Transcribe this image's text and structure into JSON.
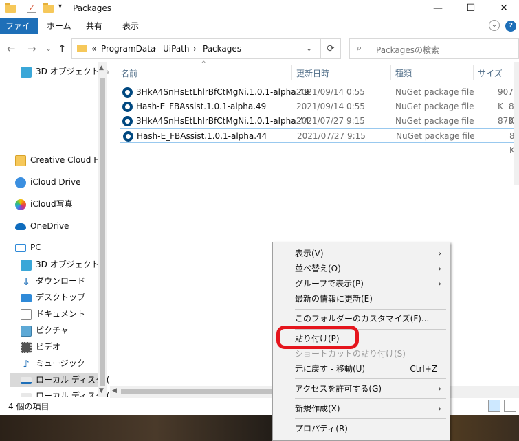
{
  "window": {
    "title": "Packages",
    "controls": {
      "minimize": "—",
      "maximize": "☐",
      "close": "✕"
    }
  },
  "ribbon": {
    "tabs": [
      "ファイル",
      "ホーム",
      "共有",
      "表示"
    ],
    "help": "?",
    "expand": "⌄"
  },
  "nav": {
    "back": "←",
    "forward": "→",
    "recent": "⌄",
    "up": "↑",
    "breadcrumb": [
      "«",
      "ProgramData",
      "›",
      "UiPath",
      "›",
      "Packages"
    ],
    "refresh": "⟳",
    "search_placeholder": "Packagesの検索",
    "search_icon": "⌕"
  },
  "sidebar": {
    "items": [
      {
        "label": "3D オブジェクト",
        "icon": "3d-objects-icon",
        "pin": "📌"
      },
      {
        "label": "Creative Cloud File",
        "icon": "creative-cloud-icon"
      },
      {
        "label": "iCloud Drive",
        "icon": "icloud-drive-icon"
      },
      {
        "label": "iCloud写真",
        "icon": "icloud-photos-icon"
      },
      {
        "label": "OneDrive",
        "icon": "onedrive-icon"
      },
      {
        "label": "PC",
        "icon": "pc-icon"
      },
      {
        "label": "3D オブジェクト",
        "icon": "3d-objects-icon"
      },
      {
        "label": "ダウンロード",
        "icon": "downloads-icon"
      },
      {
        "label": "デスクトップ",
        "icon": "desktop-icon"
      },
      {
        "label": "ドキュメント",
        "icon": "documents-icon"
      },
      {
        "label": "ピクチャ",
        "icon": "pictures-icon"
      },
      {
        "label": "ビデオ",
        "icon": "videos-icon"
      },
      {
        "label": "ミュージック",
        "icon": "music-icon"
      },
      {
        "label": "ローカル ディスク (C",
        "icon": "local-disk-icon"
      },
      {
        "label": "ローカル ディスク (D",
        "icon": "local-disk-icon"
      }
    ]
  },
  "filelist": {
    "columns": [
      "名前",
      "更新日時",
      "種類",
      "サイズ"
    ],
    "rows": [
      {
        "name": "3HkA4SnHsEtLhlrBfCtMgNi.1.0.1-alpha.49",
        "date": "2021/09/14 0:55",
        "type": "NuGet package file",
        "size": "907 K"
      },
      {
        "name": "Hash-E_FBAssist.1.0.1-alpha.49",
        "date": "2021/09/14 0:55",
        "type": "NuGet package file",
        "size": "8 K"
      },
      {
        "name": "3HkA4SnHsEtLhlrBfCtMgNi.1.0.1-alpha.44",
        "date": "2021/07/27 9:15",
        "type": "NuGet package file",
        "size": "870 K"
      },
      {
        "name": "Hash-E_FBAssist.1.0.1-alpha.44",
        "date": "2021/07/27 9:15",
        "type": "NuGet package file",
        "size": "8 K"
      }
    ]
  },
  "status": {
    "item_count": "4 個の項目"
  },
  "context_menu": {
    "items": [
      {
        "label": "表示(V)",
        "submenu": "›"
      },
      {
        "label": "並べ替え(O)",
        "submenu": "›"
      },
      {
        "label": "グループで表示(P)",
        "submenu": "›"
      },
      {
        "label": "最新の情報に更新(E)"
      },
      {
        "label": "このフォルダーのカスタマイズ(F)..."
      },
      {
        "label": "貼り付け(P)"
      },
      {
        "label": "ショートカットの貼り付け(S)"
      },
      {
        "label": "元に戻す - 移動(U)",
        "shortcut": "Ctrl+Z"
      },
      {
        "label": "アクセスを許可する(G)",
        "submenu": "›"
      },
      {
        "label": "新規作成(X)",
        "submenu": "›"
      },
      {
        "label": "プロパティ(R)"
      }
    ]
  },
  "colors": {
    "accent": "#1e6fb8",
    "highlight_ring": "#e5151d",
    "selection_border": "#99c9ef"
  }
}
